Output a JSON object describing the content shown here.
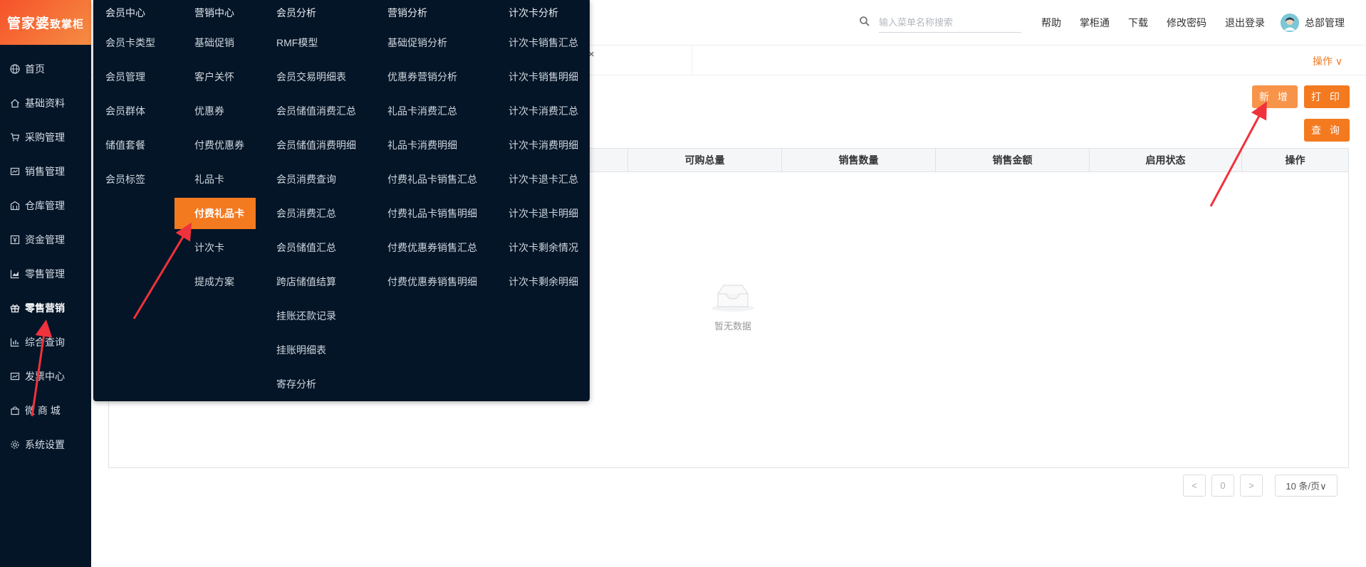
{
  "logo": {
    "main": "管家婆",
    "sub": "致掌柜"
  },
  "sidebar": {
    "items": [
      {
        "label": "首页",
        "icon": "globe-icon"
      },
      {
        "label": "基础资料",
        "icon": "home-icon"
      },
      {
        "label": "采购管理",
        "icon": "cart-icon"
      },
      {
        "label": "销售管理",
        "icon": "sales-icon"
      },
      {
        "label": "仓库管理",
        "icon": "warehouse-icon"
      },
      {
        "label": "资金管理",
        "icon": "money-icon"
      },
      {
        "label": "零售管理",
        "icon": "chart-icon"
      },
      {
        "label": "零售营销",
        "icon": "gift-icon",
        "active": true
      },
      {
        "label": "综合查询",
        "icon": "bar-chart-icon"
      },
      {
        "label": "发票中心",
        "icon": "invoice-icon"
      },
      {
        "label": "微 商 城",
        "icon": "bag-icon"
      },
      {
        "label": "系统设置",
        "icon": "gear-icon"
      }
    ]
  },
  "header": {
    "search_placeholder": "输入菜单名称搜索",
    "links": [
      "帮助",
      "掌柜通",
      "下载",
      "修改密码",
      "退出登录"
    ],
    "user": "总部管理"
  },
  "tabbar": {
    "close": "×",
    "ops": "操作 ∨"
  },
  "buttons": {
    "add": "新 增",
    "print": "打 印",
    "query": "查 询"
  },
  "table": {
    "columns": [
      "可购总量",
      "销售数量",
      "销售金额",
      "启用状态",
      "操作"
    ],
    "empty_text": "暂无数据"
  },
  "pagination": {
    "prev": "<",
    "page": "0",
    "next": ">",
    "size": "10 条/页∨"
  },
  "mega_menu": {
    "columns": [
      {
        "title": "会员中心",
        "items": [
          "会员卡类型",
          "会员管理",
          "会员群体",
          "储值套餐",
          "会员标签"
        ]
      },
      {
        "title": "营销中心",
        "items": [
          "基础促销",
          "客户关怀",
          "优惠券",
          "付费优惠券",
          "礼品卡",
          "付费礼品卡",
          "计次卡",
          "提成方案"
        ],
        "active_index": 5
      },
      {
        "title": "会员分析",
        "items": [
          "RMF模型",
          "会员交易明细表",
          "会员储值消费汇总",
          "会员储值消费明细",
          "会员消费查询",
          "会员消费汇总",
          "会员储值汇总",
          "跨店储值结算",
          "挂账还款记录",
          "挂账明细表",
          "寄存分析"
        ]
      },
      {
        "title": "营销分析",
        "items": [
          "基础促销分析",
          "优惠券营销分析",
          "礼品卡消费汇总",
          "礼品卡消费明细",
          "付费礼品卡销售汇总",
          "付费礼品卡销售明细",
          "付费优惠券销售汇总",
          "付费优惠券销售明细"
        ]
      },
      {
        "title": "计次卡分析",
        "items": [
          "计次卡销售汇总",
          "计次卡销售明细",
          "计次卡消费汇总",
          "计次卡消费明细",
          "计次卡退卡汇总",
          "计次卡退卡明细",
          "计次卡剩余情况",
          "计次卡剩余明细"
        ]
      }
    ]
  },
  "colors": {
    "accent": "#f47a20",
    "sidebar_bg": "#041527",
    "arrow": "#f0323c"
  }
}
